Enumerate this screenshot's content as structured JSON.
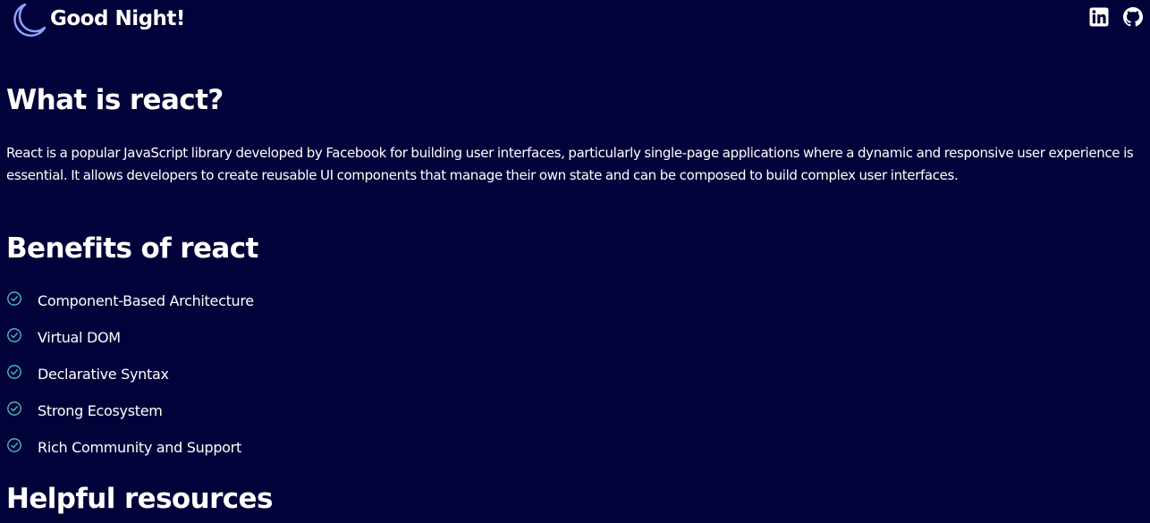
{
  "header": {
    "brand_icon": "moon-icon",
    "title": "Good Night!",
    "social": [
      {
        "icon": "linkedin-icon"
      },
      {
        "icon": "github-icon"
      }
    ]
  },
  "main": {
    "what_heading": "What is react?",
    "intro": "React is a popular JavaScript library developed by Facebook for building user interfaces, particularly single-page applications where a dynamic and responsive user experience is essential. It allows developers to create reusable UI components that manage their own state and can be composed to build complex user interfaces.",
    "benefits_heading": "Benefits of react",
    "benefits": [
      {
        "label": "Component-Based Architecture"
      },
      {
        "label": "Virtual DOM"
      },
      {
        "label": "Declarative Syntax"
      },
      {
        "label": "Strong Ecosystem"
      },
      {
        "label": "Rich Community and Support"
      }
    ],
    "resources_heading": "Helpful resources"
  },
  "colors": {
    "background": "#02023a",
    "moon": "#8fa2ff",
    "check": "#54c6c1",
    "text": "#ffffff"
  }
}
